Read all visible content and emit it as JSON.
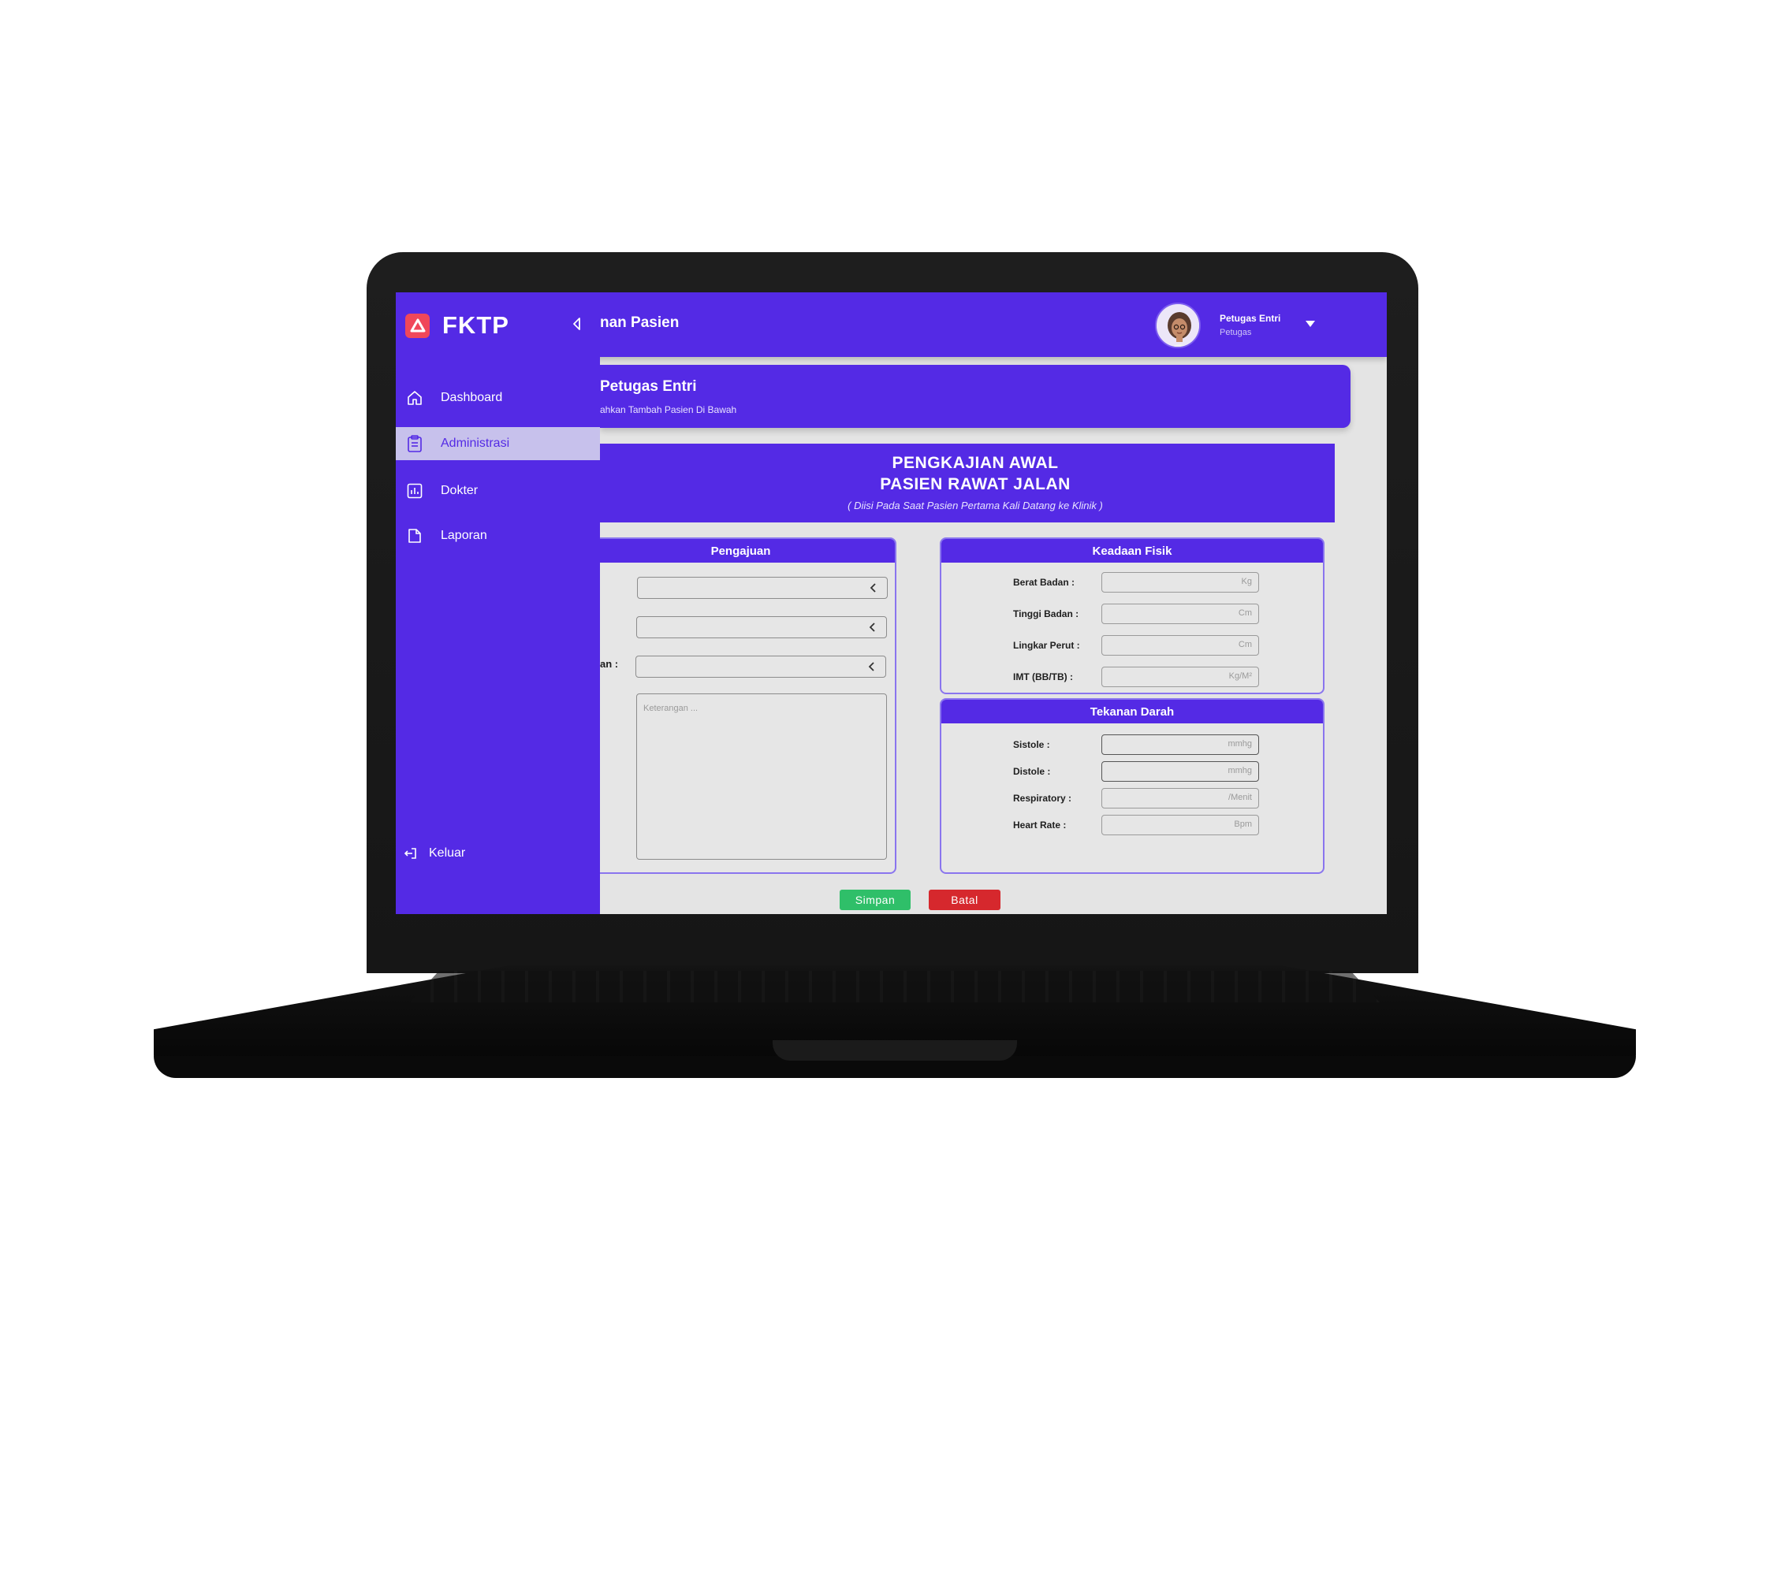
{
  "app": {
    "brand": "FKTP",
    "page_title": "nan Pasien"
  },
  "user": {
    "name": "Petugas Entri",
    "role": "Petugas"
  },
  "sidebar": {
    "items": [
      {
        "label": "Dashboard",
        "icon": "home-icon"
      },
      {
        "label": "Administrasi",
        "icon": "clipboard-icon",
        "active": true
      },
      {
        "label": "Dokter",
        "icon": "chart-icon"
      },
      {
        "label": "Laporan",
        "icon": "document-icon"
      }
    ],
    "logout_label": "Keluar"
  },
  "welcome": {
    "title": "Petugas Entri",
    "subtitle": "ahkan Tambah Pasien Di Bawah"
  },
  "form": {
    "title_line1": "PENGKAJIAN AWAL",
    "title_line2": "PASIEN RAWAT JALAN",
    "note": "( Diisi Pada Saat Pasien Pertama Kali Datang ke Klinik )"
  },
  "pengajuan": {
    "heading": "Pengajuan",
    "cut_label": "an :",
    "keterangan_placeholder": "Keterangan ..."
  },
  "keadaan_fisik": {
    "heading": "Keadaan Fisik",
    "fields": [
      {
        "label": "Berat Badan :",
        "unit": "Kg"
      },
      {
        "label": "Tinggi Badan :",
        "unit": "Cm"
      },
      {
        "label": "Lingkar Perut :",
        "unit": "Cm"
      },
      {
        "label": "IMT (BB/TB) :",
        "unit": "Kg/M²"
      }
    ]
  },
  "tekanan_darah": {
    "heading": "Tekanan Darah",
    "fields": [
      {
        "label": "Sistole :",
        "unit": "mmhg"
      },
      {
        "label": "Distole :",
        "unit": "mmhg"
      },
      {
        "label": "Respiratory :",
        "unit": "/Menit"
      },
      {
        "label": "Heart Rate :",
        "unit": "Bpm"
      }
    ]
  },
  "actions": {
    "save_label": "Simpan",
    "cancel_label": "Batal"
  },
  "colors": {
    "primary": "#542ae5",
    "active_bg": "#c7c1ec",
    "save": "#2fbf69",
    "cancel": "#d6282d",
    "logo": "#f0475a"
  }
}
